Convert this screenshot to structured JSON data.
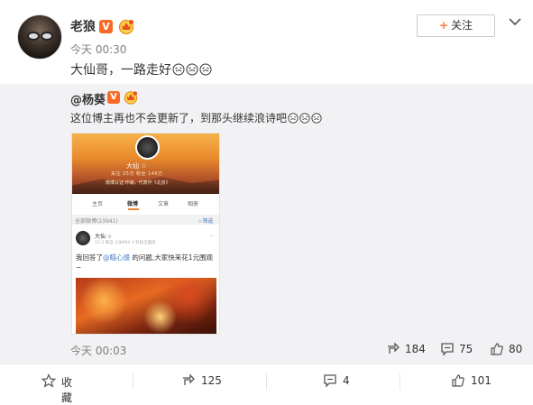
{
  "post": {
    "username": "老狼",
    "verified_badge": "V",
    "time": "今天 00:30",
    "follow_label": "关注",
    "text": "大仙哥，一路走好",
    "emoji_count": 3
  },
  "repost": {
    "username": "@杨葵",
    "verified_badge": "V",
    "text": "这位博主再也不会更新了，到那头继续浪诗吧",
    "time": "今天 00:03",
    "actions": {
      "forward": "184",
      "comment": "75",
      "like": "80"
    },
    "screenshot": {
      "profile_name": "大仙 ☆",
      "stats": "关注 25万   粉丝 146万",
      "desc": "微博认证:作家，代表作《北京》",
      "tabs": [
        "主页",
        "微博",
        "文章",
        "相册"
      ],
      "count_label": "全部微博(23941)",
      "filter_label": "☆筛选",
      "post_name": "大仙 ☆",
      "post_meta": "11-3 来自 小米MIX 3 科技全面屏",
      "post_text_before": "我回答了",
      "post_mention": "@瞄心熳",
      "post_text_after": " 的问题,大家快来花1元围观~"
    }
  },
  "bottom": {
    "collect": "收藏",
    "forward": "125",
    "comment": "4",
    "like": "101"
  },
  "colors": {
    "accent": "#fa7d3c",
    "verified": "#f86a26",
    "repost_bg": "#f2f2f5",
    "link": "#4a7fc0"
  }
}
